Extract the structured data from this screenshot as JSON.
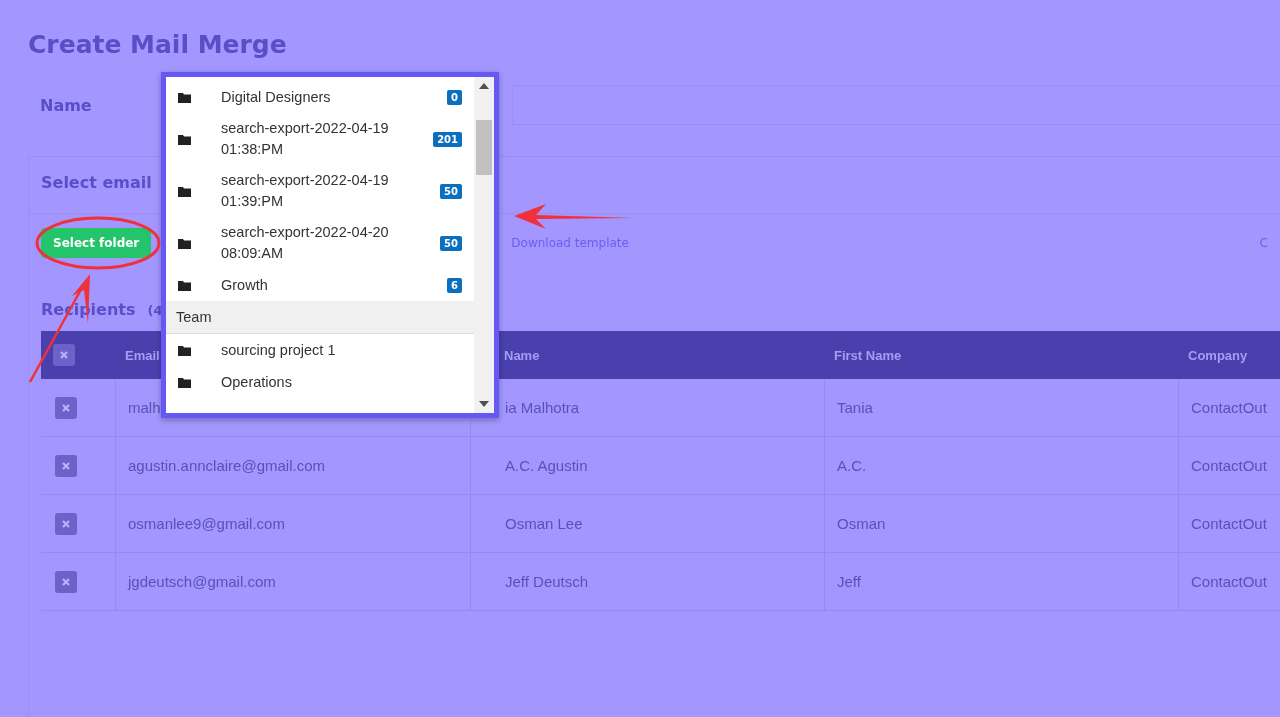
{
  "page": {
    "title": "Create Mail Merge",
    "name_label": "Name"
  },
  "section": {
    "title": "Select email",
    "select_button": "Select folder",
    "download_link": "Download template",
    "edge_text": "C"
  },
  "recipients": {
    "title": "Recipients",
    "count": "(4",
    "columns": [
      "Email",
      "Name",
      "First Name",
      "Company"
    ],
    "rows": [
      {
        "email": "malh",
        "name": "ia Malhotra",
        "first_name": "Tania",
        "company": "ContactOut"
      },
      {
        "email": "agustin.annclaire@gmail.com",
        "name": "A.C. Agustin",
        "first_name": "A.C.",
        "company": "ContactOut"
      },
      {
        "email": "osmanlee9@gmail.com",
        "name": "Osman Lee",
        "first_name": "Osman",
        "company": "ContactOut"
      },
      {
        "email": "jgdeutsch@gmail.com",
        "name": "Jeff Deutsch",
        "first_name": "Jeff",
        "company": "ContactOut"
      }
    ]
  },
  "folder_dropdown": {
    "items": [
      {
        "kind": "folder",
        "label": "Digital Designers",
        "count": "0"
      },
      {
        "kind": "folder",
        "label": "search-export-2022-04-19\n01:38:PM",
        "count": "201"
      },
      {
        "kind": "folder",
        "label": "search-export-2022-04-19\n01:39:PM",
        "count": "50"
      },
      {
        "kind": "folder",
        "label": "search-export-2022-04-20\n08:09:AM",
        "count": "50"
      },
      {
        "kind": "folder",
        "label": "Growth",
        "count": "6"
      },
      {
        "kind": "group",
        "label": "Team"
      },
      {
        "kind": "folder",
        "label": "sourcing project 1"
      },
      {
        "kind": "folder",
        "label": "Operations"
      }
    ]
  }
}
